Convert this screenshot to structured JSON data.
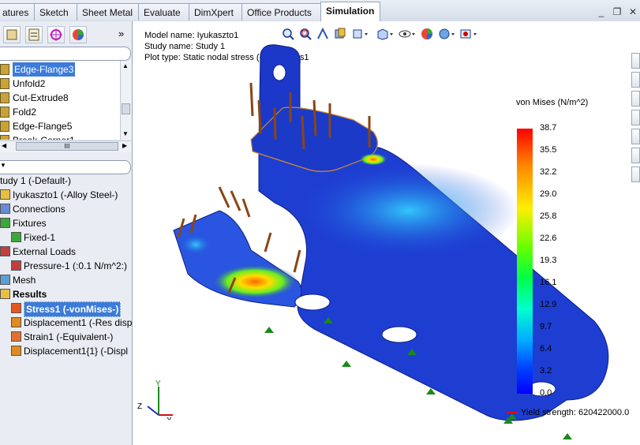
{
  "tabs": [
    {
      "label": "atures",
      "active": false
    },
    {
      "label": "Sketch",
      "active": false
    },
    {
      "label": "Sheet Metal",
      "active": false
    },
    {
      "label": "Evaluate",
      "active": false
    },
    {
      "label": "DimXpert",
      "active": false
    },
    {
      "label": "Office Products",
      "active": false
    },
    {
      "label": "Simulation",
      "active": true
    }
  ],
  "window_controls": {
    "minimize": "_",
    "restore": "❐",
    "close": "✕"
  },
  "panel": {
    "collapse_glyph": "»",
    "features": [
      {
        "label": "Edge-Flange3",
        "selected": true,
        "icon": "edge-flange-icon"
      },
      {
        "label": "Unfold2",
        "selected": false,
        "icon": "unfold-icon"
      },
      {
        "label": "Cut-Extrude8",
        "selected": false,
        "icon": "cut-extrude-icon"
      },
      {
        "label": "Fold2",
        "selected": false,
        "icon": "fold-icon"
      },
      {
        "label": "Edge-Flange5",
        "selected": false,
        "icon": "edge-flange-icon"
      },
      {
        "label": "Break-Corner1",
        "selected": false,
        "icon": "break-corner-icon"
      }
    ],
    "scroll_grip": "III",
    "study_tree": [
      {
        "label": "tudy 1 (-Default-)",
        "indent": 0,
        "icon": "",
        "bold": false,
        "selected": false
      },
      {
        "label": "Iyukaszto1 (-Alloy Steel-)",
        "indent": 0,
        "icon": "part-icon",
        "bold": false,
        "selected": false
      },
      {
        "label": "Connections",
        "indent": 0,
        "icon": "connections-icon",
        "bold": false,
        "selected": false
      },
      {
        "label": "Fixtures",
        "indent": 0,
        "icon": "fixtures-icon",
        "bold": false,
        "selected": false
      },
      {
        "label": "Fixed-1",
        "indent": 1,
        "icon": "fixed-icon",
        "bold": false,
        "selected": false
      },
      {
        "label": "External Loads",
        "indent": 0,
        "icon": "external-loads-icon",
        "bold": false,
        "selected": false
      },
      {
        "label": "Pressure-1 (:0.1 N/m^2:)",
        "indent": 1,
        "icon": "pressure-icon",
        "bold": false,
        "selected": false
      },
      {
        "label": "Mesh",
        "indent": 0,
        "icon": "mesh-icon",
        "bold": false,
        "selected": false
      },
      {
        "label": "Results",
        "indent": 0,
        "icon": "results-folder-icon",
        "bold": true,
        "selected": false
      },
      {
        "label": "Stress1 (-vonMises-)",
        "indent": 1,
        "icon": "stress-plot-icon",
        "bold": true,
        "selected": true
      },
      {
        "label": "Displacement1 (-Res disp",
        "indent": 1,
        "icon": "displacement-plot-icon",
        "bold": false,
        "selected": false
      },
      {
        "label": "Strain1 (-Equivalent-)",
        "indent": 1,
        "icon": "strain-plot-icon",
        "bold": false,
        "selected": false
      },
      {
        "label": "Displacement1{1} (-Displ",
        "indent": 1,
        "icon": "displacement-plot-icon",
        "bold": false,
        "selected": false
      }
    ]
  },
  "plot_info": {
    "model_name": "Model name: Iyukaszto1",
    "study_name": "Study name: Study 1",
    "plot_type": "Plot type: Static nodal stress (-Plot Stress1"
  },
  "legend": {
    "title": "von Mises (N/m^2)",
    "ticks": [
      "38.7",
      "35.5",
      "32.2",
      "29.0",
      "25.8",
      "22.6",
      "19.3",
      "16.1",
      "12.9",
      "9.7",
      "6.4",
      "3.2",
      "0.0"
    ],
    "yield_text": "Yield strength: 620422000.0"
  },
  "triad": {
    "x": "X",
    "y": "Y",
    "z": "Z"
  },
  "colors": {
    "accent": "#3b7bd9",
    "part_blue": "#1438c8",
    "load_arrow": "#a0522d",
    "fixture_green": "#1a8a1a"
  }
}
